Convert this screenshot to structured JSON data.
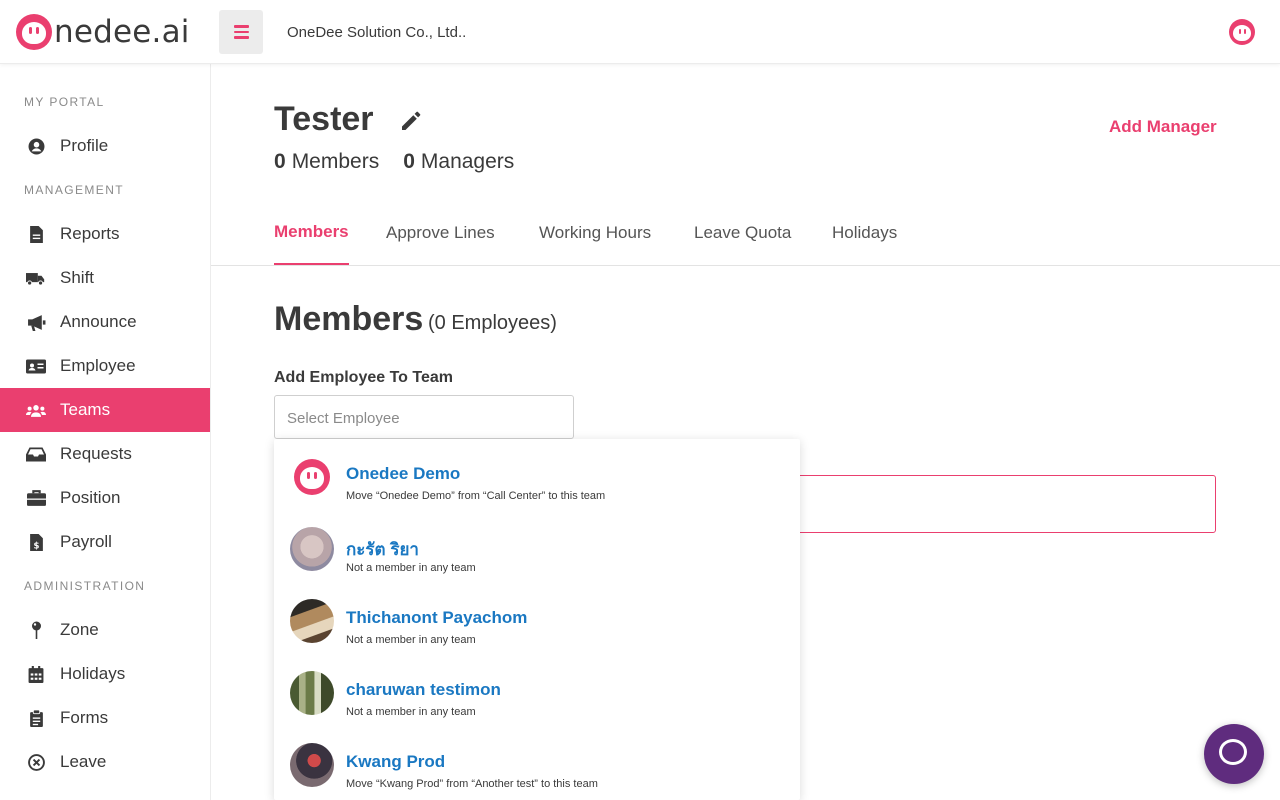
{
  "app": {
    "logo_text": "nedee.ai",
    "company": "OneDee Solution Co., Ltd..",
    "brand_color": "#ea3f6f",
    "link_color": "#1a78c2"
  },
  "sidebar": {
    "sections": {
      "my_portal": "MY PORTAL",
      "management": "MANAGEMENT",
      "administration": "ADMINISTRATION"
    },
    "items": [
      {
        "label": "Profile",
        "icon": "user-circle-icon"
      },
      {
        "label": "Reports",
        "icon": "document-icon"
      },
      {
        "label": "Shift",
        "icon": "truck-clock-icon"
      },
      {
        "label": "Announce",
        "icon": "megaphone-icon"
      },
      {
        "label": "Employee",
        "icon": "id-card-icon"
      },
      {
        "label": "Teams",
        "icon": "users-icon",
        "active": true
      },
      {
        "label": "Requests",
        "icon": "inbox-icon"
      },
      {
        "label": "Position",
        "icon": "briefcase-icon"
      },
      {
        "label": "Payroll",
        "icon": "invoice-dollar-icon"
      },
      {
        "label": "Zone",
        "icon": "map-pin-icon"
      },
      {
        "label": "Holidays",
        "icon": "calendar-icon"
      },
      {
        "label": "Forms",
        "icon": "clipboard-icon"
      },
      {
        "label": "Leave",
        "icon": "circle-x-icon"
      }
    ]
  },
  "team": {
    "name": "Tester",
    "members_count": "0",
    "members_label": "Members",
    "managers_count": "0",
    "managers_label": "Managers",
    "add_manager": "Add Manager"
  },
  "tabs": [
    {
      "label": "Members",
      "active": true
    },
    {
      "label": "Approve Lines"
    },
    {
      "label": "Working Hours"
    },
    {
      "label": "Leave Quota"
    },
    {
      "label": "Holidays"
    }
  ],
  "members_section": {
    "title": "Members",
    "count_text": "(0 Employees)",
    "add_label": "Add Employee To Team",
    "select_placeholder": "Select Employee"
  },
  "dropdown_options": [
    {
      "name": "Onedee Demo",
      "sub": "Move “Onedee Demo” from “Call Center” to this team"
    },
    {
      "name": "กะรัต ริยา",
      "sub": "Not a member in any team"
    },
    {
      "name": "Thichanont Payachom",
      "sub": "Not a member in any team"
    },
    {
      "name": "charuwan testimon",
      "sub": "Not a member in any team"
    },
    {
      "name": "Kwang Prod",
      "sub": "Move “Kwang Prod” from “Another test” to this team"
    }
  ]
}
